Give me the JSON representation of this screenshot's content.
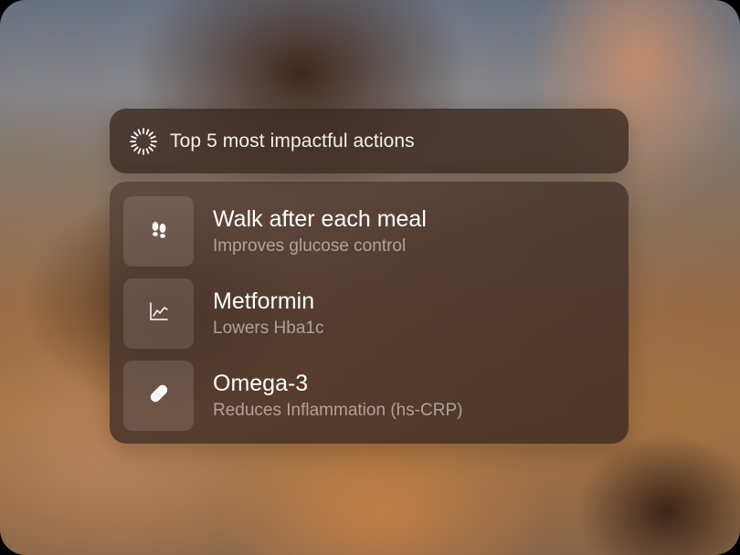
{
  "header": {
    "icon": "loader-icon",
    "title": "Top 5 most impactful actions"
  },
  "actions": [
    {
      "icon": "footprints-icon",
      "title": "Walk after each meal",
      "subtitle": "Improves glucose control"
    },
    {
      "icon": "line-chart-icon",
      "title": "Metformin",
      "subtitle": "Lowers Hba1c"
    },
    {
      "icon": "pill-icon",
      "title": "Omega-3",
      "subtitle": "Reduces Inflammation (hs-CRP)"
    }
  ],
  "colors": {
    "card_background": "#3e2a22",
    "text_primary": "#ffffff",
    "text_secondary": "#ebded8"
  }
}
